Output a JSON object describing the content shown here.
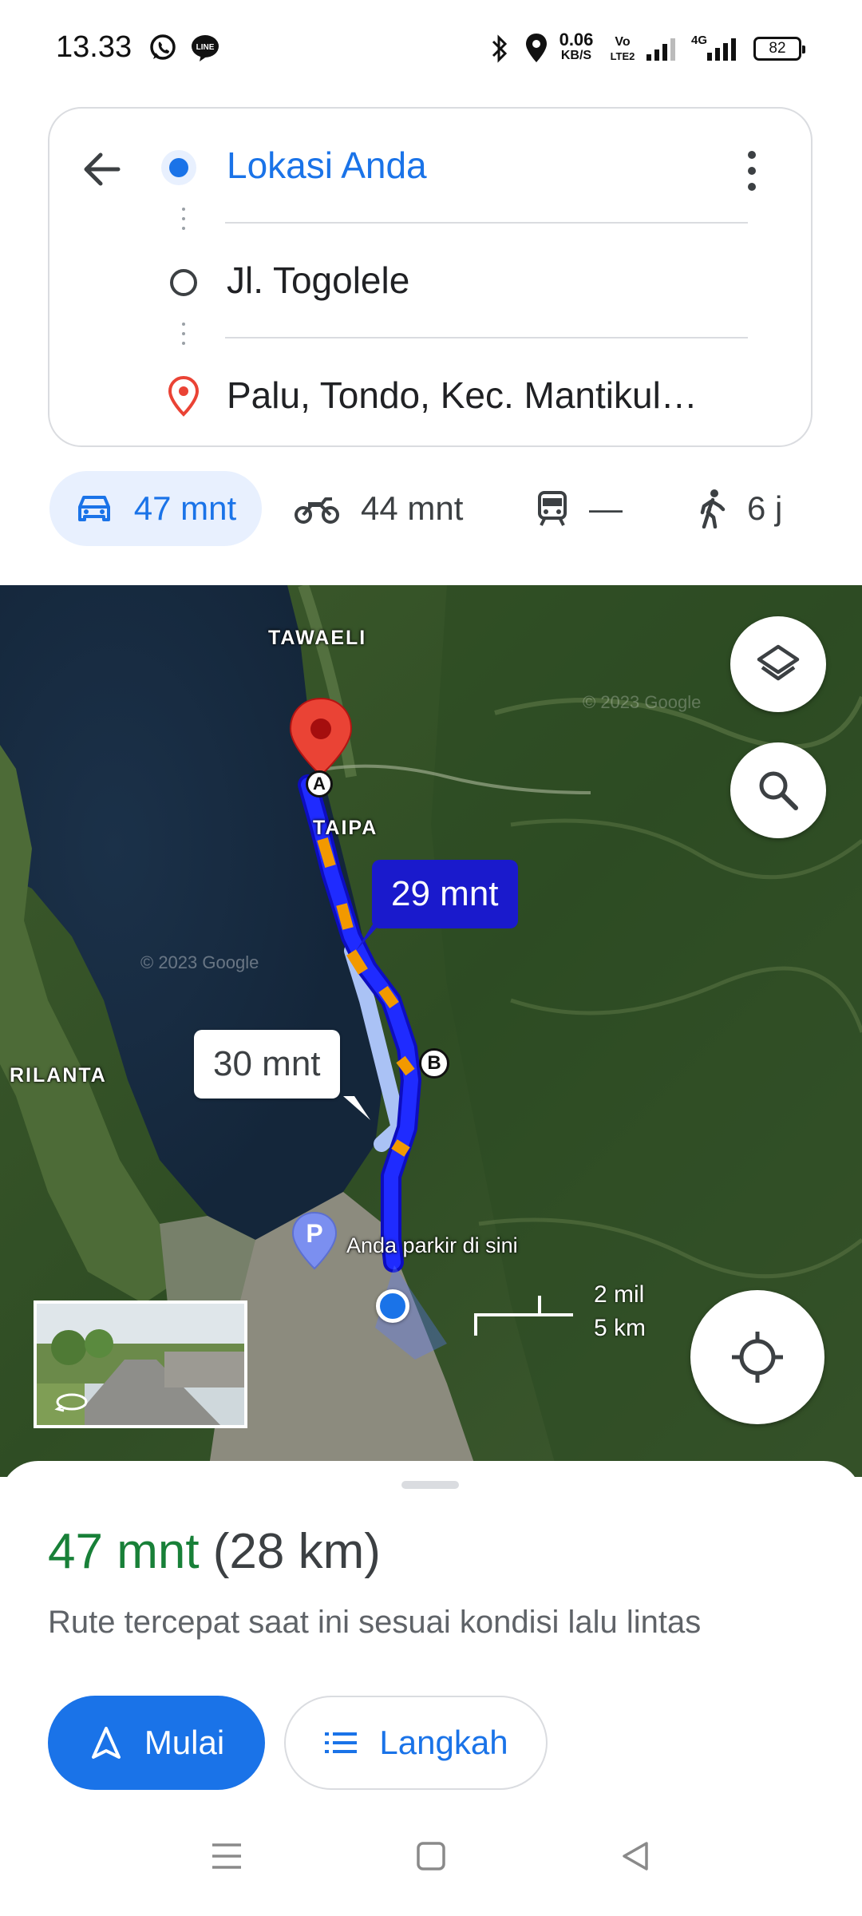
{
  "status_bar": {
    "time": "13.33",
    "net_speed_top": "0.06",
    "net_speed_bottom": "KB/S",
    "volte_top": "Vo",
    "volte_bottom": "LTE2",
    "network_type": "4G",
    "battery": "82"
  },
  "directions": {
    "origin": "Lokasi Anda",
    "waypoint": "Jl. Togolele",
    "destination": "Palu, Tondo, Kec. Mantikul…"
  },
  "travel_modes": [
    {
      "name": "car",
      "label": "47 mnt",
      "active": true
    },
    {
      "name": "motorcycle",
      "label": "44 mnt",
      "active": false
    },
    {
      "name": "transit",
      "label": "—",
      "active": false
    },
    {
      "name": "walk",
      "label": "6 j",
      "active": false
    }
  ],
  "map": {
    "labels": {
      "tawaeli": "TAWAELI",
      "taipa": "TAIPA",
      "rilanta": "RILANTA",
      "parking": "Anda parkir di sini",
      "watermark1": "© 2023 Google",
      "watermark2": "© 2023 Google"
    },
    "route_primary_time": "29 mnt",
    "route_alt_time": "30 mnt",
    "marker_a": "A",
    "marker_b": "B",
    "parking_marker": "P",
    "scale_miles": "2 mil",
    "scale_km": "5 km"
  },
  "bottom_sheet": {
    "eta_time": "47 mnt",
    "eta_distance": "(28 km)",
    "route_description": "Rute tercepat saat ini sesuai kondisi lalu lintas",
    "start_label": "Mulai",
    "steps_label": "Langkah"
  },
  "colors": {
    "accent_blue": "#1a73e8",
    "eta_green": "#188038",
    "route_blue": "#1a1aff",
    "traffic_orange": "#f29900",
    "pin_red": "#ea4335"
  }
}
